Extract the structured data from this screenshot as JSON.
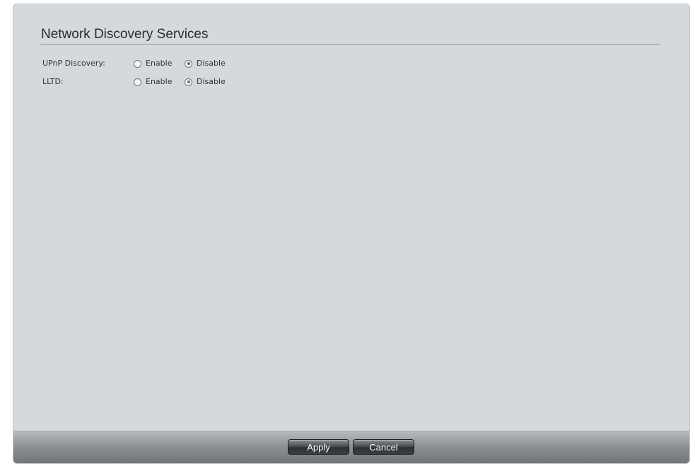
{
  "section": {
    "title": "Network Discovery Services"
  },
  "settings": {
    "upnp": {
      "label": "UPnP Discovery:",
      "enable_label": "Enable",
      "disable_label": "Disable",
      "selected": "Disable"
    },
    "lltd": {
      "label": "LLTD:",
      "enable_label": "Enable",
      "disable_label": "Disable",
      "selected": "Disable"
    }
  },
  "footer": {
    "apply_label": "Apply",
    "cancel_label": "Cancel"
  },
  "colors": {
    "panel_background": "#d6d9dc",
    "selected_radio_dot": "#3c8a3c",
    "button_background": "#3b3e40"
  }
}
